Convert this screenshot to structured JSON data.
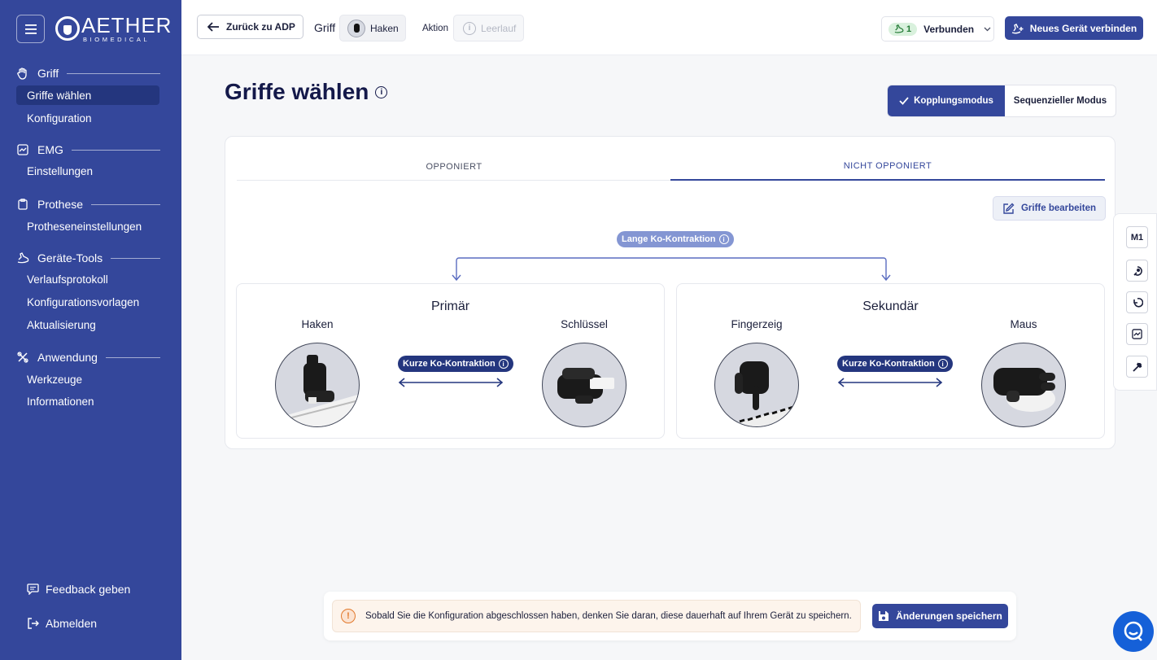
{
  "brand": {
    "name": "AETHER",
    "sub": "BIOMEDICAL"
  },
  "sidebar": {
    "sections": [
      {
        "label": "Griff",
        "items": [
          "Griffe wählen",
          "Konfiguration"
        ]
      },
      {
        "label": "EMG",
        "items": [
          "Einstellungen"
        ]
      },
      {
        "label": "Prothese",
        "items": [
          "Protheseneinstellungen"
        ]
      },
      {
        "label": "Geräte-Tools",
        "items": [
          "Verlaufsprotokoll",
          "Konfigurationsvorlagen",
          "Aktualisierung"
        ]
      },
      {
        "label": "Anwendung",
        "items": [
          "Werkzeuge",
          "Informationen"
        ]
      }
    ],
    "feedback": "Feedback geben",
    "logout": "Abmelden"
  },
  "header": {
    "back": "Zurück zu ADP",
    "griff_label": "Griff",
    "griff_value": "Haken",
    "aktion_label": "Aktion",
    "aktion_value": "Leerlauf",
    "connected_count": "1",
    "connected_label": "Verbunden",
    "new_device": "Neues Gerät verbinden"
  },
  "main": {
    "title": "Griffe wählen",
    "mode_active": "Kopplungsmodus",
    "mode_other": "Sequenzieller Modus",
    "tabs": [
      "OPPONIERT",
      "NICHT OPPONIERT"
    ],
    "edit": "Griffe bearbeiten",
    "long_contraction": "Lange Ko-Kontraktion",
    "short_contraction": "Kurze Ko-Kontraktion",
    "primary": {
      "title": "Primär",
      "left": "Haken",
      "right": "Schlüssel"
    },
    "secondary": {
      "title": "Sekundär",
      "left": "Fingerzeig",
      "right": "Maus"
    }
  },
  "tools": {
    "m1": "M1"
  },
  "save_bar": {
    "note": "Sobald Sie die Konfiguration abgeschlossen haben, denken Sie daran, diese dauerhaft auf Ihrem Gerät zu speichern.",
    "button": "Änderungen speichern"
  },
  "colors": {
    "primary": "#34479b",
    "sidebar": "#34479b",
    "accent_light": "#8496d3",
    "warning": "#e2792c",
    "chat": "#1560d8"
  }
}
